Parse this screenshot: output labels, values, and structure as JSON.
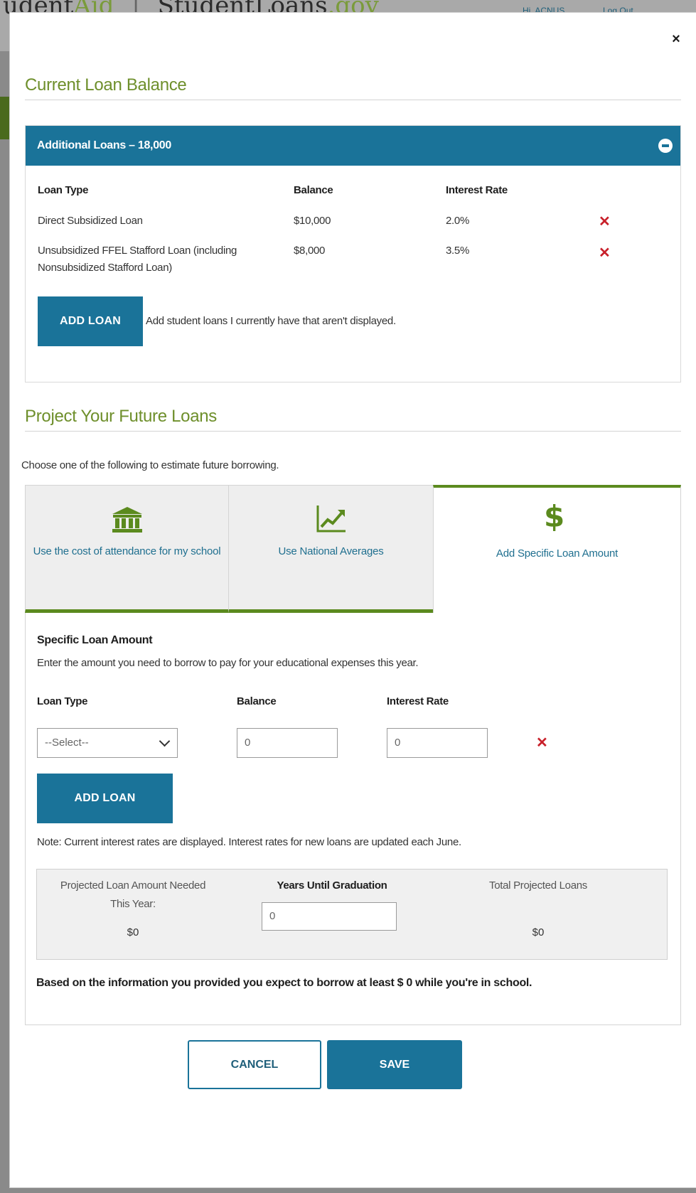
{
  "background": {
    "brand_left": "udent",
    "brand_left_green": "Aid",
    "brand_right": "StudentLoans",
    "brand_right_green": ".gov",
    "user_greeting": "Hi, ACNUS",
    "logout_label": "Log Out"
  },
  "modal": {
    "close_symbol": "×"
  },
  "current_loans": {
    "section_title": "Current Loan Balance",
    "panel_header": "Additional Loans – 18,000",
    "columns": {
      "loan_type": "Loan Type",
      "balance": "Balance",
      "interest_rate": "Interest Rate"
    },
    "rows": [
      {
        "loan_type": "Direct Subsidized Loan",
        "balance": "$10,000",
        "rate": "2.0%"
      },
      {
        "loan_type": "Unsubsidized FFEL Stafford Loan (including Nonsubsidized Stafford Loan)",
        "balance": "$8,000",
        "rate": "3.5%"
      }
    ],
    "add_loan_label": "ADD LOAN",
    "add_loan_note": "Add student loans I currently have that aren't displayed."
  },
  "future_loans": {
    "section_title": "Project Your Future Loans",
    "intro": "Choose one of the following to estimate future borrowing.",
    "tabs": [
      {
        "label": "Use the cost of attendance for my school",
        "icon": "bank-icon"
      },
      {
        "label": "Use National Averages",
        "icon": "chart-trend-icon"
      },
      {
        "label": "Add Specific Loan Amount",
        "icon": "dollar-icon"
      }
    ],
    "specific": {
      "title": "Specific Loan Amount",
      "description": "Enter the amount you need to borrow to pay for your educational expenses this year.",
      "col_loan_type": "Loan Type",
      "col_balance": "Balance",
      "col_interest_rate": "Interest Rate",
      "select_value": "--Select--",
      "balance_value": "0",
      "rate_value": "0",
      "add_loan_label": "ADD LOAN",
      "note": "Note: Current interest rates are displayed. Interest rates for new loans are updated each June."
    },
    "summary": {
      "projected_label": "Projected Loan Amount Needed This Year:",
      "projected_value": "$0",
      "years_label": "Years Until Graduation",
      "years_value": "0",
      "total_label": "Total Projected Loans",
      "total_value": "$0"
    },
    "summary_text": "Based on the information you provided you expect to borrow at least $ 0 while you're in school."
  },
  "actions": {
    "cancel_label": "CANCEL",
    "save_label": "SAVE"
  },
  "colors": {
    "primary_blue": "#1a7399",
    "accent_green": "#6e8f2b",
    "tab_green": "#5b8a1e",
    "remove_red": "#c8202a"
  }
}
